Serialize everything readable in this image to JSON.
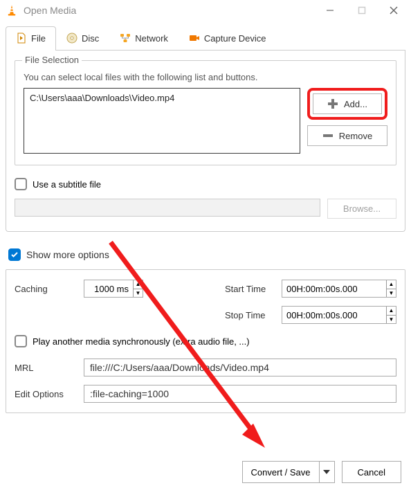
{
  "titlebar": {
    "title": "Open Media"
  },
  "tabs": {
    "file": "File",
    "disc": "Disc",
    "network": "Network",
    "capture": "Capture Device"
  },
  "fileSelection": {
    "legend": "File Selection",
    "help": "You can select local files with the following list and buttons.",
    "files": [
      "C:\\Users\\aaa\\Downloads\\Video.mp4"
    ],
    "add": "Add...",
    "remove": "Remove"
  },
  "subtitle": {
    "label": "Use a subtitle file",
    "browse": "Browse..."
  },
  "showMoreOptions": "Show more options",
  "opts": {
    "cachingLabel": "Caching",
    "cachingValue": "1000 ms",
    "startLabel": "Start Time",
    "startValue": "00H:00m:00s.000",
    "stopLabel": "Stop Time",
    "stopValue": "00H:00m:00s.000",
    "playSync": "Play another media synchronously (extra audio file, ...)",
    "mrlLabel": "MRL",
    "mrlValue": "file:///C:/Users/aaa/Downloads/Video.mp4",
    "editLabel": "Edit Options",
    "editValue": ":file-caching=1000"
  },
  "footer": {
    "convert": "Convert / Save",
    "cancel": "Cancel"
  }
}
